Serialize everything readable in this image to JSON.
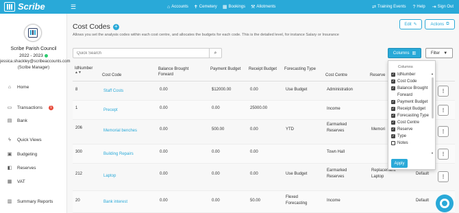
{
  "brand": {
    "name": "Scribe"
  },
  "nav": {
    "items": [
      {
        "label": "Accounts",
        "icon": "bank-icon"
      },
      {
        "label": "Cemetery",
        "icon": "cross-icon"
      },
      {
        "label": "Bookings",
        "icon": "calendar-icon"
      },
      {
        "label": "Allotments",
        "icon": "spade-icon"
      }
    ],
    "right": [
      {
        "label": "Training Events",
        "icon": "graduation-icon"
      },
      {
        "label": "Help",
        "icon": "question-icon"
      },
      {
        "label": "Sign Out",
        "icon": "signout-icon"
      }
    ]
  },
  "sidebar": {
    "council": "Scribe Parish Council",
    "year": "2022 - 2023",
    "email": "jessica.shackley@scribeaccounts.com",
    "role": "(Scribe Manager)",
    "items": [
      {
        "label": "Home",
        "icon": "home-icon"
      },
      {
        "label": "Transactions",
        "icon": "transactions-icon",
        "badge": "1"
      },
      {
        "label": "Bank",
        "icon": "bank-icon"
      },
      {
        "label": "Quick Views",
        "icon": "bolt-icon"
      },
      {
        "label": "Budgeting",
        "icon": "budget-icon"
      },
      {
        "label": "Reserves",
        "icon": "reserves-icon"
      },
      {
        "label": "VAT",
        "icon": "vat-icon"
      },
      {
        "label": "Summary Reports",
        "icon": "reports-icon"
      }
    ]
  },
  "page": {
    "title": "Cost Codes",
    "subtitle": "Allows you set the analysis codes within each cost centre, and allocates the budgets for each code. This is the detailed level, for instance Salary or Insurance",
    "edit_label": "Edit",
    "actions_label": "Actions"
  },
  "search": {
    "placeholder": "Quick Search"
  },
  "toolbar": {
    "columns_label": "Columns",
    "filter_label": "Filter"
  },
  "table": {
    "headers": [
      "IdNumber",
      "Cost Code",
      "Balance Brought Forward",
      "Payment Budget",
      "Receipt Budget",
      "Forecasting Type",
      "Cost Centre",
      "Reserve"
    ],
    "rows": [
      {
        "id": "8",
        "code": "Staff Costs",
        "bbf": "0.00",
        "pay": "$12000.00",
        "rec": "0.00",
        "fc": "Use Budget",
        "cc": "Administration",
        "reserve": "",
        "extra": ""
      },
      {
        "id": "1",
        "code": "Precept",
        "bbf": "0.00",
        "pay": "0.00",
        "rec": "25000.00",
        "fc": "",
        "cc": "Income",
        "reserve": "",
        "extra": ""
      },
      {
        "id": "206",
        "code": "Memorial benches",
        "bbf": "0.00",
        "pay": "500.00",
        "rec": "0.00",
        "fc": "YTD",
        "cc": "Earmarked Reserves",
        "reserve": "Memori",
        "extra": ""
      },
      {
        "id": "300",
        "code": "Building Repairs",
        "bbf": "0.00",
        "pay": "0.00",
        "rec": "0.00",
        "fc": "",
        "cc": "Town Hall",
        "reserve": "",
        "extra": ""
      },
      {
        "id": "212",
        "code": "Laptop",
        "bbf": "0.00",
        "pay": "0.00",
        "rec": "0.00",
        "fc": "Use Budget",
        "cc": "Earmarked Reserves",
        "reserve": "Replacement Laptop",
        "extra": "Default"
      },
      {
        "id": "20",
        "code": "Bank interest",
        "bbf": "0.00",
        "pay": "0.00",
        "rec": "50.00",
        "fc": "Flexed Forecasting",
        "cc": "Income",
        "reserve": "",
        "extra": "Default"
      }
    ]
  },
  "columns_dropdown": {
    "title": "Columns",
    "items": [
      {
        "label": "IdNumber",
        "checked": true
      },
      {
        "label": "Cost Code",
        "checked": true
      },
      {
        "label": "Balance Brought Forward",
        "checked": true
      },
      {
        "label": "Payment Budget",
        "checked": true
      },
      {
        "label": "Receipt Budget",
        "checked": true
      },
      {
        "label": "Forecasting Type",
        "checked": true
      },
      {
        "label": "Cost Centre",
        "checked": true
      },
      {
        "label": "Reserve",
        "checked": true
      },
      {
        "label": "Type",
        "checked": true
      },
      {
        "label": "Notes",
        "checked": false
      }
    ],
    "apply_label": "Apply"
  },
  "colors": {
    "accent": "#29a9d8",
    "badge": "#e74c3c",
    "status": "#2ecc71"
  }
}
